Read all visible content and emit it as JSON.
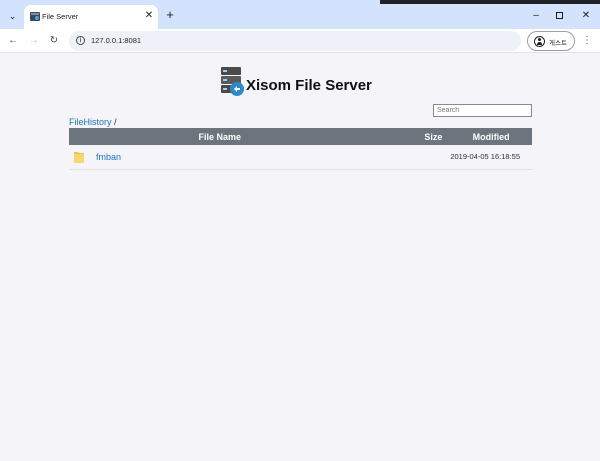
{
  "browser": {
    "tab_title": "File Server",
    "tab_close_glyph": "✕",
    "new_tab_glyph": "+",
    "tab_search_glyph": "⌄",
    "url": "127.0.0.1:8081",
    "profile_label": "게스트",
    "back_glyph": "←",
    "forward_glyph": "→",
    "reload_glyph": "↻",
    "menu_glyph": "⋮",
    "minimize_glyph": "–",
    "close_glyph": "✕"
  },
  "page": {
    "site_title": "Xisom File Server",
    "search_placeholder": "Search",
    "breadcrumb": {
      "root_link": "FileHistory",
      "separator": " /"
    },
    "table": {
      "headers": {
        "name": "File Name",
        "size": "Size",
        "modified": "Modified"
      },
      "rows": [
        {
          "name": "fmban",
          "size": "",
          "modified": "2019-04-05 16:18:55",
          "icon": "folder-icon"
        }
      ]
    }
  },
  "colors": {
    "tab_strip": "#d3e3fd",
    "table_header": "#6c757d",
    "link": "#1a73c8",
    "page_background": "#f4f4f9"
  }
}
